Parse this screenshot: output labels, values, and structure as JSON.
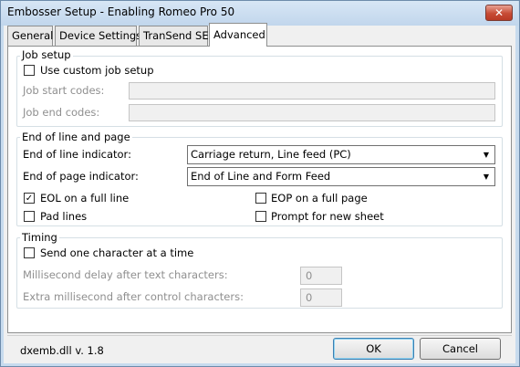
{
  "window": {
    "title": "Embosser Setup - Enabling Romeo Pro 50",
    "close": "✕"
  },
  "tabs": [
    "General",
    "Device Settings",
    "TranSend SE",
    "Advanced"
  ],
  "job_setup": {
    "legend": "Job setup",
    "use_custom": {
      "label": "Use custom job setup",
      "checked": false
    },
    "start_codes_label": "Job start codes:",
    "end_codes_label": "Job end codes:"
  },
  "eol": {
    "legend": "End of line and page",
    "eol_indicator_label": "End of line indicator:",
    "eol_indicator_value": "Carriage return, Line feed (PC)",
    "eop_indicator_label": "End of page indicator:",
    "eop_indicator_value": "End of Line and Form Feed",
    "eol_full_line": {
      "label": "EOL on a full line",
      "checked": true,
      "mark": "✓"
    },
    "eop_full_page": {
      "label": "EOP on a full page",
      "checked": false
    },
    "pad_lines": {
      "label": "Pad lines",
      "checked": false
    },
    "prompt_new_sheet": {
      "label": "Prompt for new sheet",
      "checked": false
    }
  },
  "timing": {
    "legend": "Timing",
    "send_one_char": {
      "label": "Send one character at a time",
      "checked": false
    },
    "ms_delay_label": "Millisecond delay after text characters:",
    "ms_delay_value": "0",
    "extra_ms_label": "Extra millisecond after control characters:",
    "extra_ms_value": "0"
  },
  "footer": {
    "version": "dxemb.dll  v. 1.8",
    "ok": "OK",
    "cancel": "Cancel"
  },
  "dropdown_arrow": "▼"
}
